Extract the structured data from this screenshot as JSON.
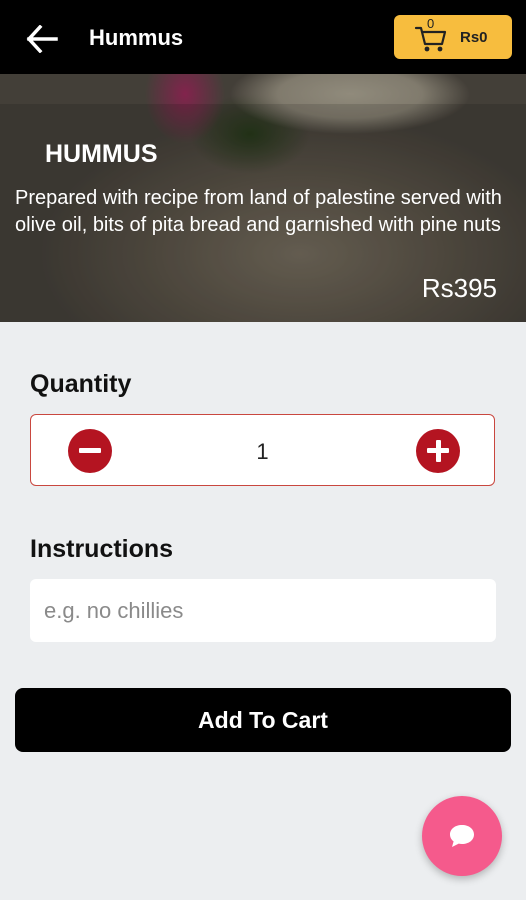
{
  "header": {
    "title": "Hummus",
    "back_icon": "arrow-left-icon",
    "cart": {
      "icon": "cart-icon",
      "count": "0",
      "total": "Rs0",
      "color": "#f7bd3e"
    }
  },
  "item": {
    "name": "HUMMUS",
    "description": "Prepared with recipe from land of palestine served with olive oil, bits of pita bread and garnished with pine nuts",
    "price": "Rs395"
  },
  "quantity": {
    "label": "Quantity",
    "value": "1",
    "minus_icon": "minus-circle-icon",
    "plus_icon": "plus-circle-icon",
    "accent": "#b41421"
  },
  "instructions": {
    "label": "Instructions",
    "placeholder": "e.g. no chillies",
    "value": ""
  },
  "actions": {
    "add_to_cart_label": "Add To Cart"
  },
  "chat": {
    "icon": "chat-bubble-icon",
    "color": "#f55a8c"
  }
}
